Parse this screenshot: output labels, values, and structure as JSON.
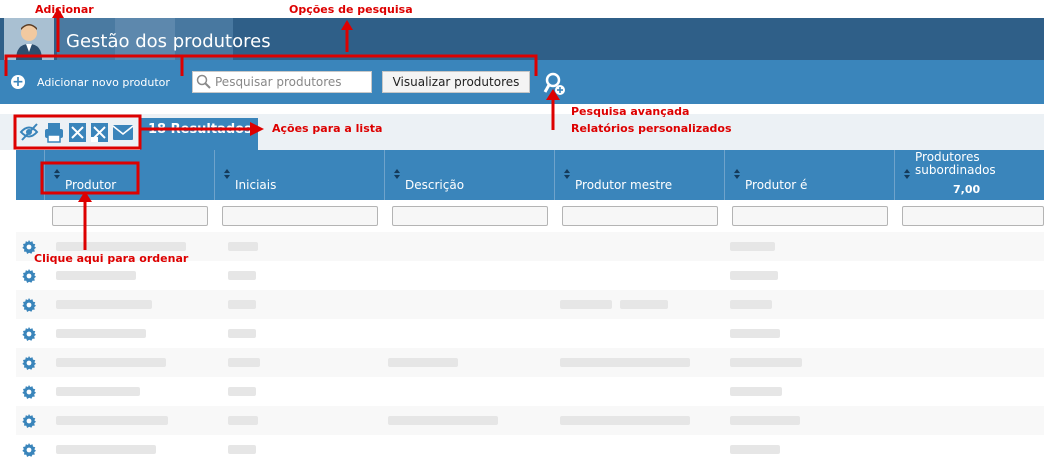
{
  "header": {
    "title": "Gestão dos produtores"
  },
  "toolbar": {
    "add_label": "Adicionar novo produtor",
    "search_placeholder": "Pesquisar produtores",
    "view_button": "Visualizar produtores"
  },
  "list": {
    "results_tab": "18 Resultados",
    "columns": [
      {
        "label": "Produtor"
      },
      {
        "label": "Iniciais"
      },
      {
        "label": "Descrição"
      },
      {
        "label": "Produtor mestre"
      },
      {
        "label": "Produtor é"
      },
      {
        "label": "Produtores subordinados",
        "total": "7,00"
      }
    ]
  },
  "annotations": {
    "add": "Adicionar",
    "search_options": "Opções de pesquisa",
    "advanced_1": "Pesquisa avançada",
    "advanced_2": "Relatórios personalizados",
    "list_actions": "Ações para a lista",
    "sort_hint": "Clique aqui para ordenar"
  },
  "colors": {
    "header": "#2f5f88",
    "toolbar": "#3a85bb",
    "annotation": "#dd0000"
  }
}
